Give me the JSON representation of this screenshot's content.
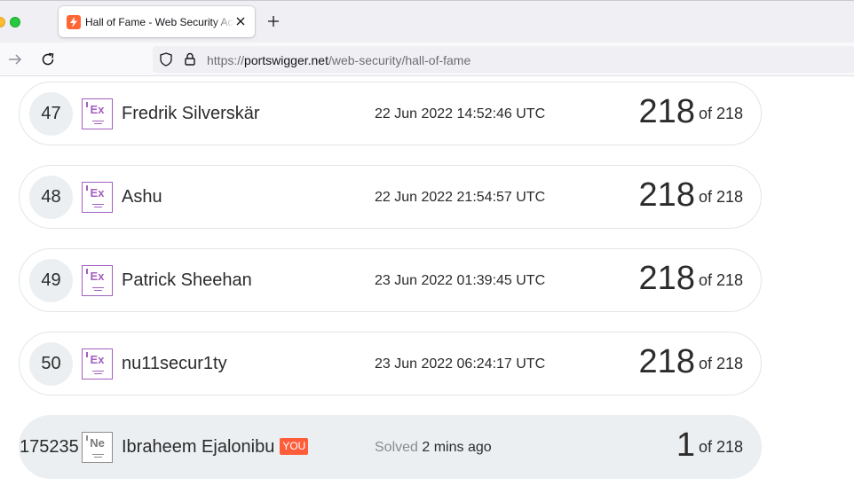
{
  "browser": {
    "tab_title": "Hall of Fame - Web Security Academy",
    "url_scheme": "https://",
    "url_host": "portswigger.net",
    "url_path": "/web-security/hall-of-fame",
    "colors": {
      "favicon": "#ff6633"
    }
  },
  "leaderboard": {
    "rows": [
      {
        "rank": "47",
        "level_badge": "Ex",
        "name": "Fredrik Silverskär",
        "date": "22 Jun 2022 14:52:46 UTC",
        "score": "218",
        "of_total": "of 218"
      },
      {
        "rank": "48",
        "level_badge": "Ex",
        "name": "Ashu",
        "date": "22 Jun 2022 21:54:57 UTC",
        "score": "218",
        "of_total": "of 218"
      },
      {
        "rank": "49",
        "level_badge": "Ex",
        "name": "Patrick Sheehan",
        "date": "23 Jun 2022 01:39:45 UTC",
        "score": "218",
        "of_total": "of 218"
      },
      {
        "rank": "50",
        "level_badge": "Ex",
        "name": "nu11secur1ty",
        "date": "23 Jun 2022 06:24:17 UTC",
        "score": "218",
        "of_total": "of 218"
      }
    ],
    "current_user": {
      "rank": "175235",
      "level_badge": "Ne",
      "name": "Ibraheem Ejalonibu",
      "you_tag": "YOU",
      "solved_label": "Solved",
      "solved_time": "2 mins ago",
      "score": "1",
      "of_total": "of 218"
    },
    "colors": {
      "expert_badge": "#a25fbf",
      "novice_badge": "#8c8c8c",
      "you_tag": "#ff5d3a",
      "highlight_row": "#ebeff2"
    }
  }
}
